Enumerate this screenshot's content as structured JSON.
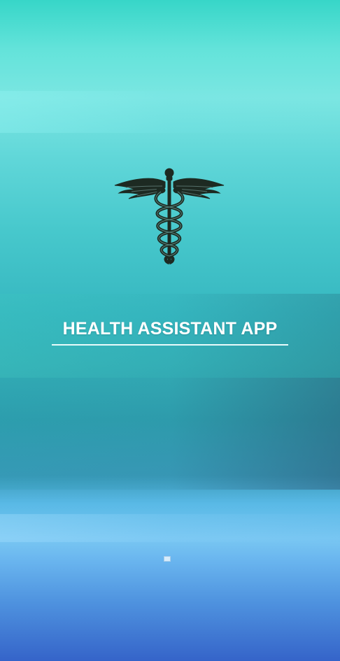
{
  "app": {
    "title": "HEALTH ASSISTANT APP",
    "logo_icon": "caduceus-icon"
  },
  "colors": {
    "title_text": "#ffffff",
    "logo_fill": "#1d2a22",
    "background_top": "#37d6c8",
    "background_bottom": "#3564c9"
  }
}
